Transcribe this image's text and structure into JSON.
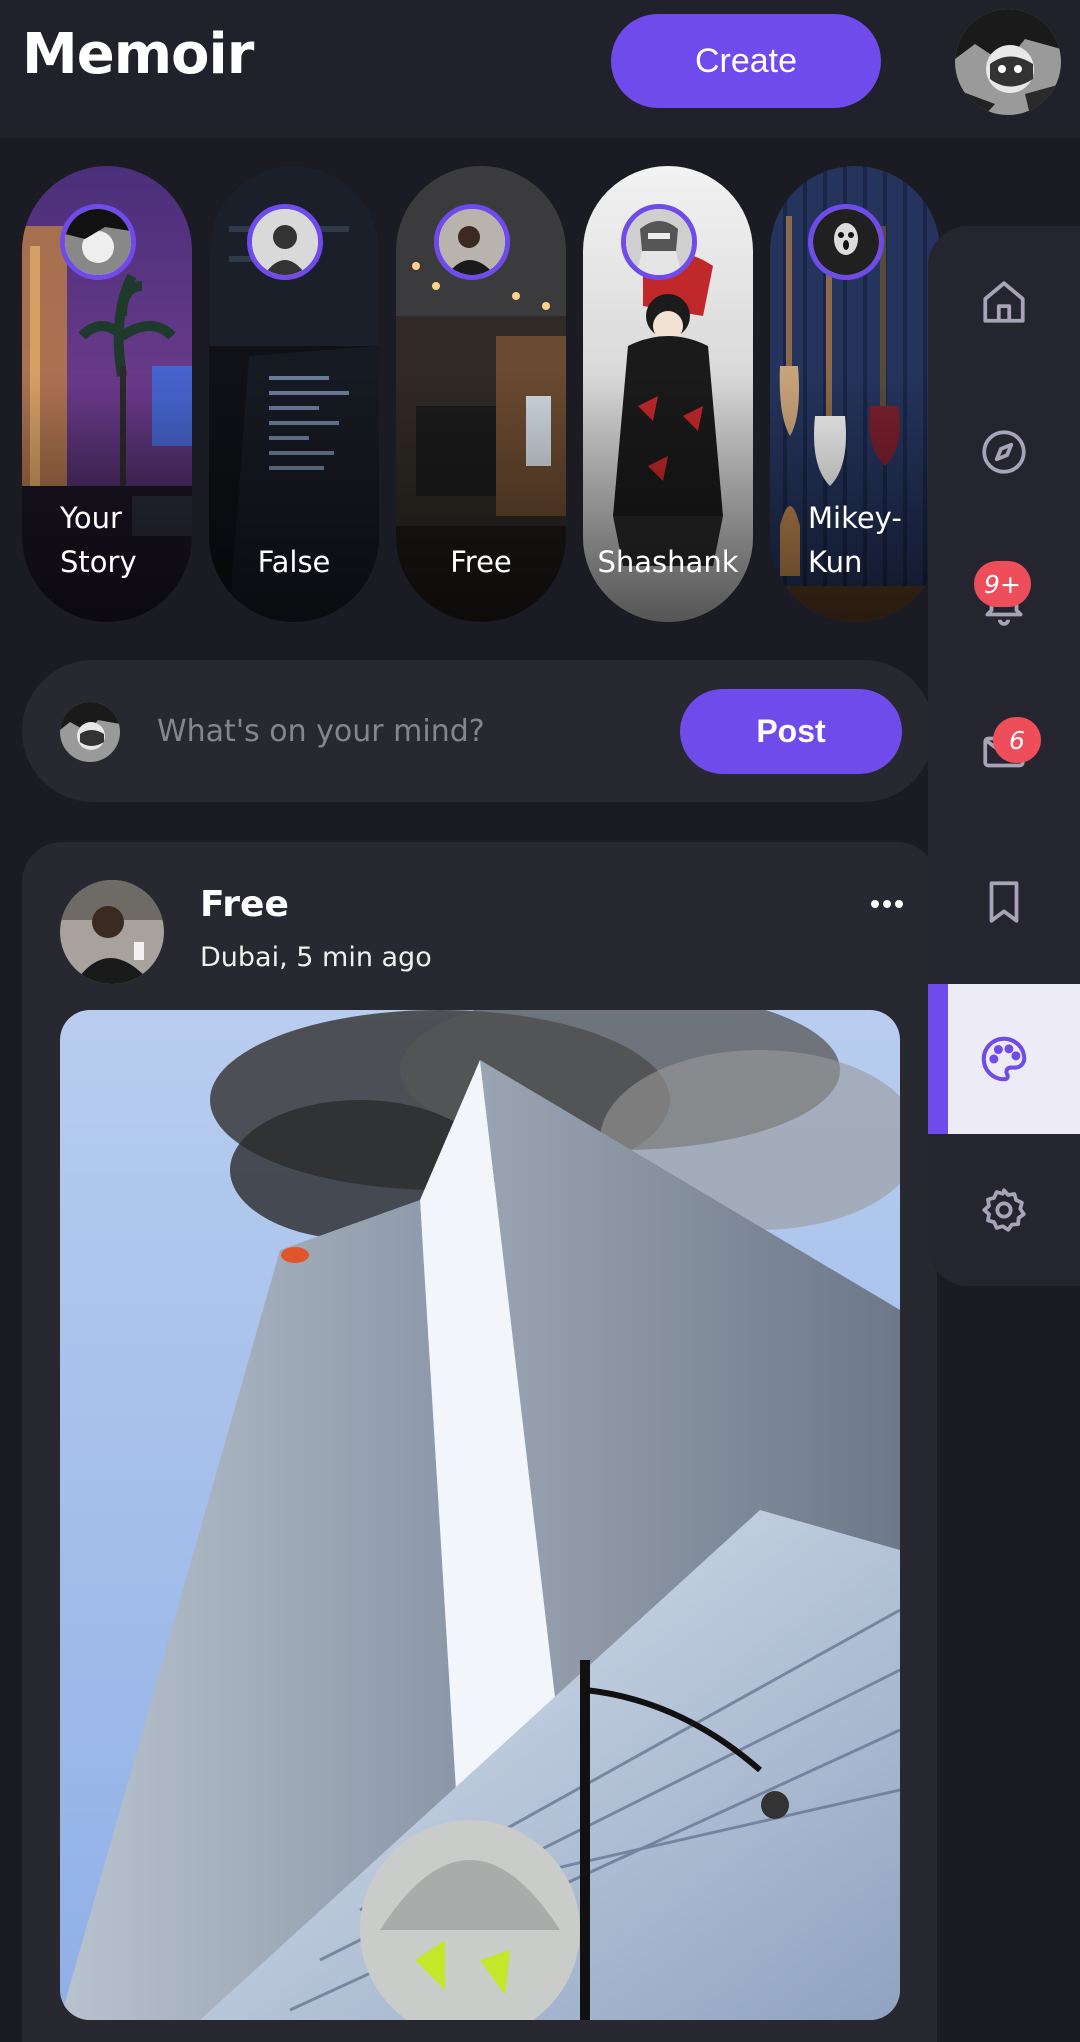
{
  "header": {
    "logo": "Memoir",
    "create_label": "Create",
    "accent": "#6e4bea"
  },
  "stories": [
    {
      "label": "Your\nStory"
    },
    {
      "label": "False"
    },
    {
      "label": "Free"
    },
    {
      "label": "Shashank"
    },
    {
      "label": "Mikey-\nKun"
    }
  ],
  "composer": {
    "placeholder": "What's on your mind?",
    "post_label": "Post"
  },
  "post": {
    "author": "Free",
    "meta": "Dubai, 5 min ago",
    "more_icon": "more-dots-icon",
    "image_icon": "post-image"
  },
  "nav": {
    "items": [
      {
        "icon": "home-icon"
      },
      {
        "icon": "compass-icon"
      },
      {
        "icon": "bell-icon",
        "badge": "9+"
      },
      {
        "icon": "mail-icon",
        "badge": "6"
      },
      {
        "icon": "bookmark-icon"
      },
      {
        "icon": "palette-icon",
        "active": true
      },
      {
        "icon": "settings-icon"
      }
    ],
    "badge_color": "#ee4d5a"
  }
}
